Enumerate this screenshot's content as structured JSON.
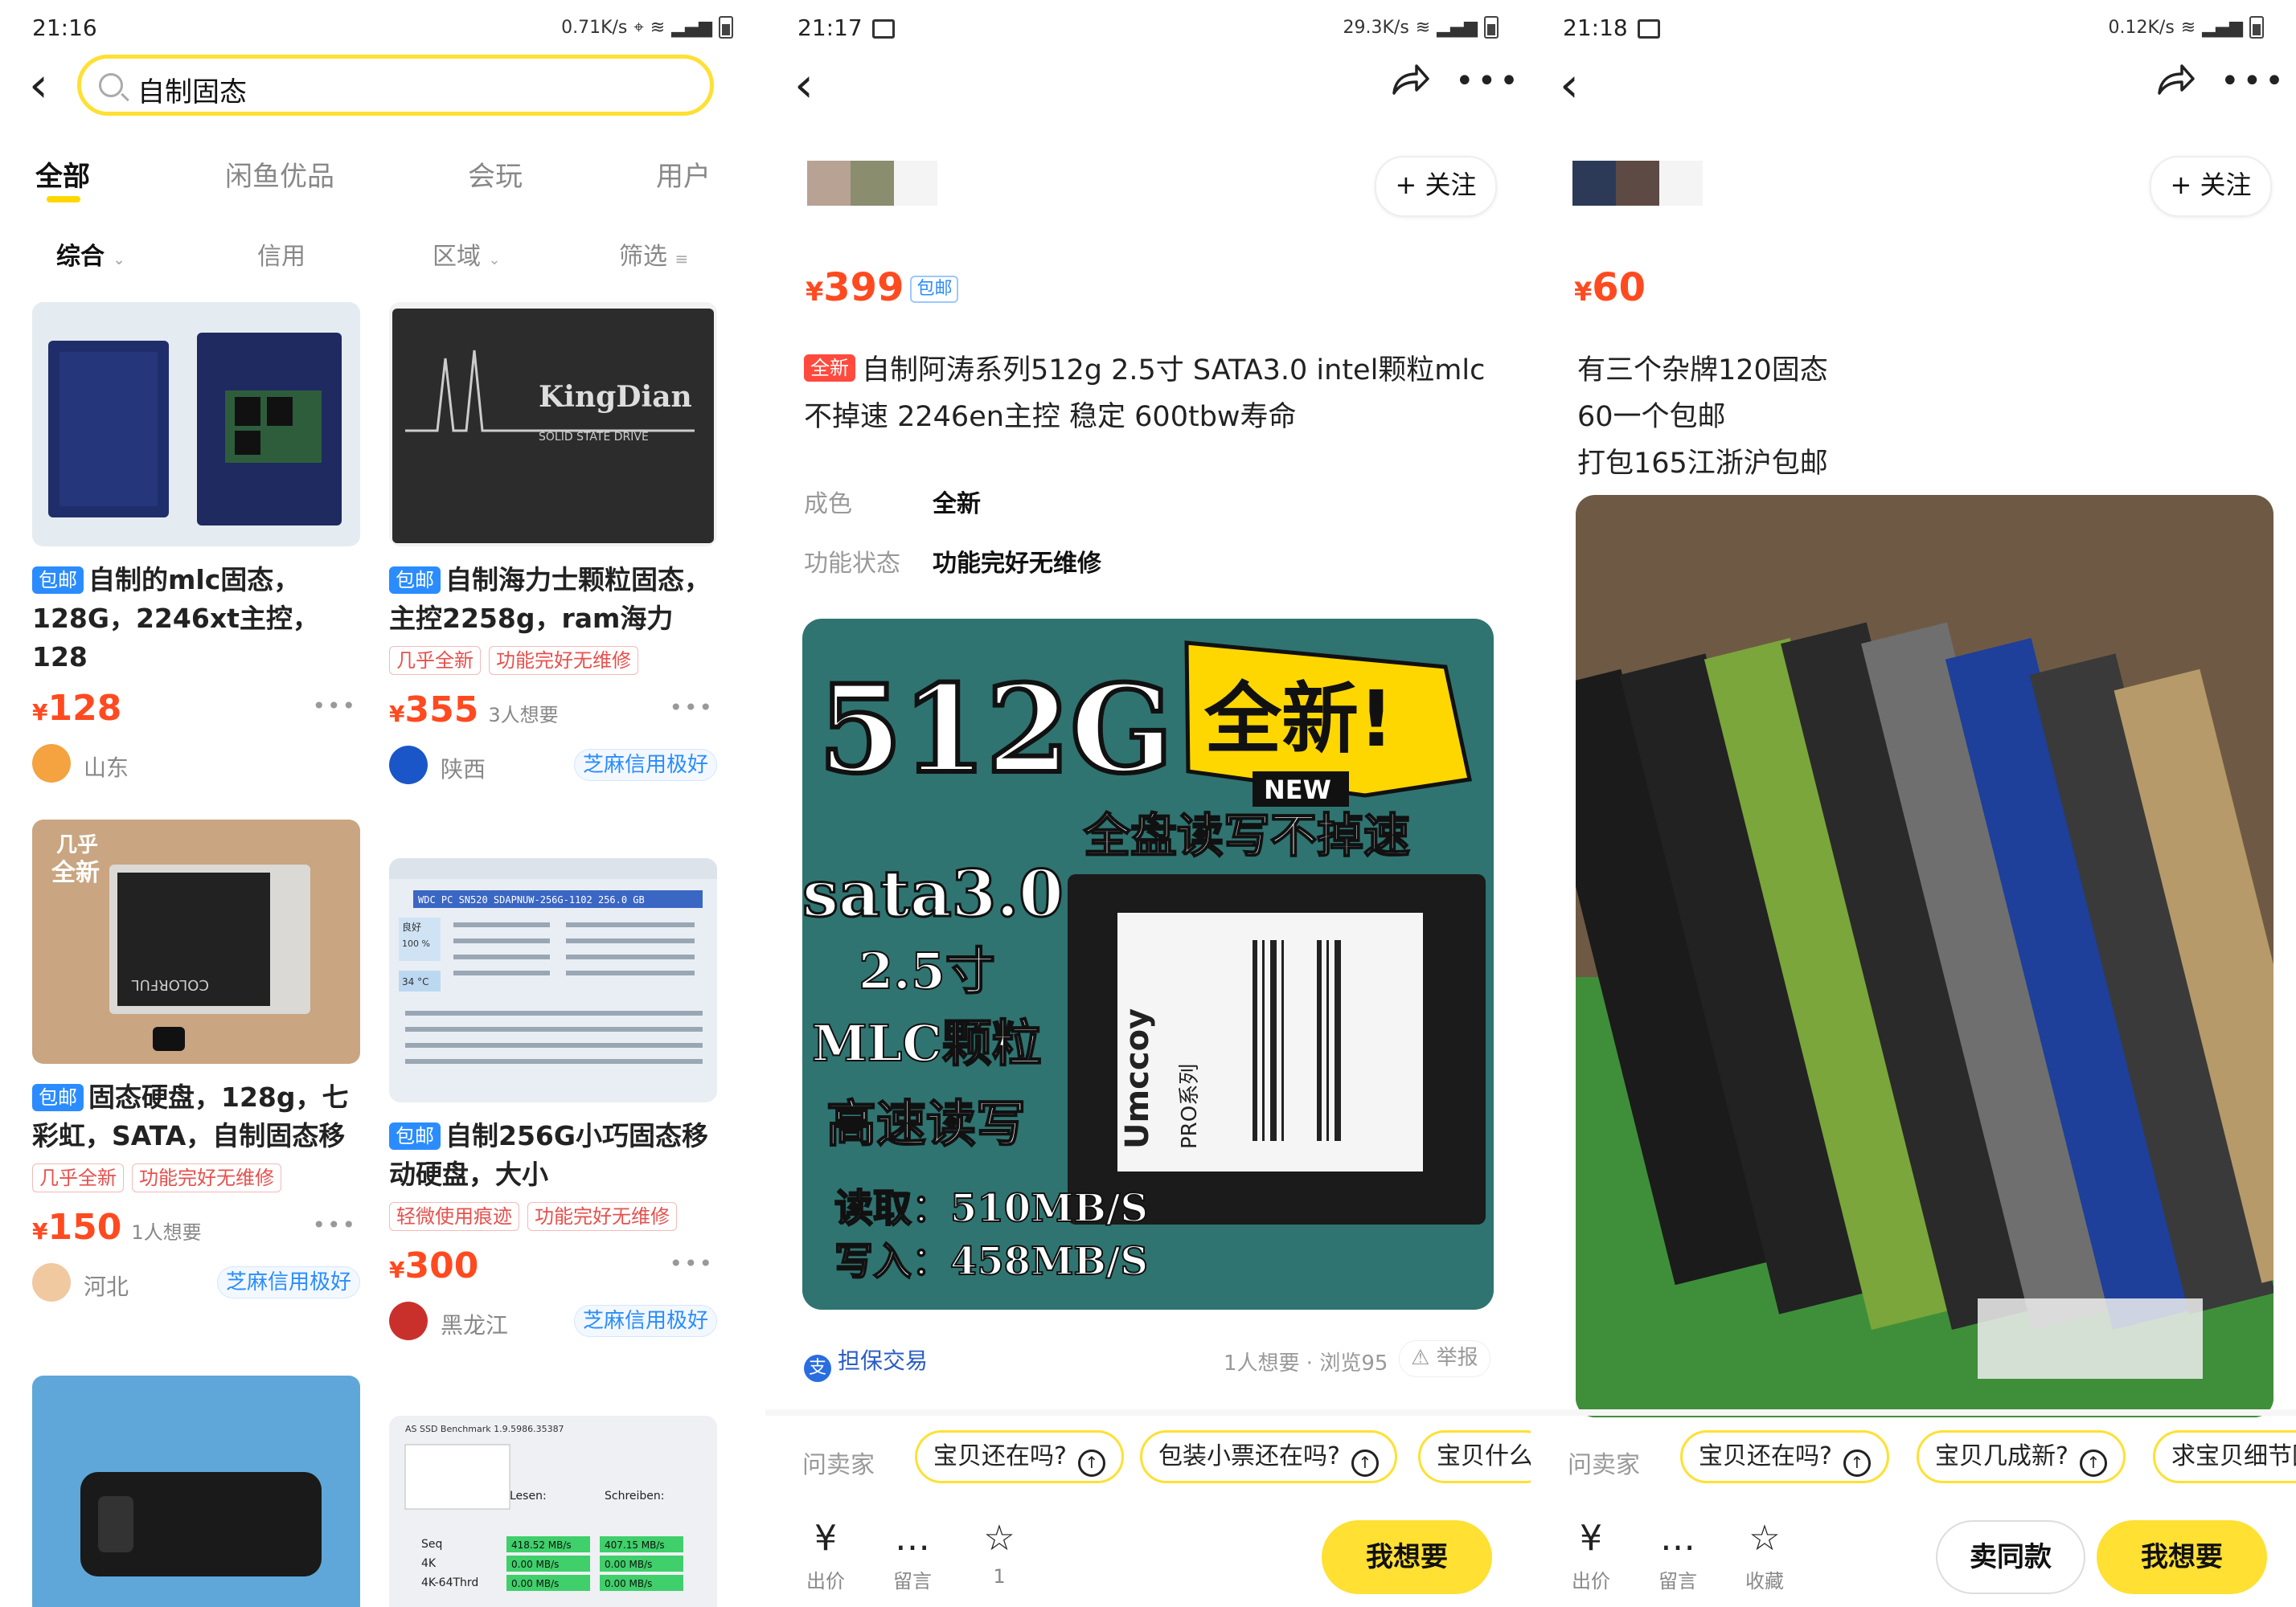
{
  "colors": {
    "accent": "#ffe033",
    "price": "#ff4a20",
    "badge_blue": "#2a8cff",
    "tag_red": "#e8504c"
  },
  "screens": [
    {
      "status": {
        "time": "21:16",
        "speed": "0.71K/s"
      },
      "search": {
        "value": "自制固态"
      },
      "tabs": [
        "全部",
        "闲鱼优品",
        "会玩",
        "用户"
      ],
      "filters": [
        "综合",
        "信用",
        "区域",
        "筛选"
      ],
      "cards": [
        {
          "badge": "包邮",
          "title": "自制的mlc固态，128G，2246xt主控，128",
          "tags": [],
          "price": "128",
          "want": "",
          "location": "山东",
          "credit": ""
        },
        {
          "badge": "包邮",
          "title": "自制海力士颗粒固态，主控2258g，ram海力",
          "tags": [
            "几乎全新",
            "功能完好无维修"
          ],
          "price": "355",
          "want": "3人想要",
          "location": "陕西",
          "credit": "芝麻信用极好",
          "image_text": [
            "KingDian",
            "SOLID STATE DRIVE"
          ]
        },
        {
          "badge": "包邮",
          "title": "固态硬盘，128g，七彩虹，SATA，自制固态移",
          "tags": [
            "几乎全新",
            "功能完好无维修"
          ],
          "price": "150",
          "want": "1人想要",
          "location": "河北",
          "credit": "芝麻信用极好",
          "image_text": [
            "几乎",
            "全新",
            "COLORFUL"
          ]
        },
        {
          "badge": "包邮",
          "title": "自制256G小巧固态移动硬盘，大小",
          "tags": [
            "轻微使用痕迹",
            "功能完好无维修"
          ],
          "price": "300",
          "want": "",
          "location": "黑龙江",
          "credit": "芝麻信用极好",
          "image_text": [
            "WDC PC SN520 SDAPNUW-256G-1102 256.0 GB",
            "良好",
            "100 %",
            "34 °C"
          ]
        },
        {
          "badge": "",
          "title": "",
          "tags": [],
          "price": "",
          "want": "",
          "location": "",
          "credit": ""
        },
        {
          "badge": "",
          "title": "",
          "tags": [],
          "price": "",
          "want": "",
          "location": "",
          "credit": "",
          "image_text": [
            "AS SSD Benchmark 1.9.5986.35387",
            "Lesen:",
            "Schreiben:",
            "Seq",
            "4K",
            "4K-64Thrd",
            "418.52 MB/s",
            "407.15 MB/s",
            "0.00 MB/s",
            "0.00 MB/s",
            "0.00 MB/s",
            "0.00 MB/s"
          ]
        }
      ]
    },
    {
      "status": {
        "time": "21:17",
        "speed": "29.3K/s"
      },
      "follow": "+ 关注",
      "price": "399",
      "price_badge": "包邮",
      "new_tag": "全新",
      "title": "自制阿涛系列512g 2.5寸 SATA3.0  intel颗粒mlc 不掉速 2246en主控 稳定   600tbw寿命",
      "attrs": [
        {
          "k": "成色",
          "v": "全新"
        },
        {
          "k": "功能状态",
          "v": "功能完好无维修"
        }
      ],
      "image_text": {
        "size": "512G",
        "new": "全新!",
        "new_en": "NEW",
        "slogan": "全盘读写不掉速",
        "iface": "sata3.0",
        "form": "2.5寸",
        "chip": "MLC颗粒",
        "speed": "高速读写",
        "read": "读取：510MB/S",
        "write": "写入：458MB/S",
        "brand": "Umccoy",
        "series": "PRO系列"
      },
      "escrow": "担保交易",
      "views": "1人想要 · 浏览95",
      "report": "举报",
      "ask_label": "问卖家",
      "questions": [
        "宝贝还在吗?",
        "包装小票还在吗?",
        "宝贝什么"
      ],
      "actions": [
        {
          "icon": "¥",
          "label": "出价"
        },
        {
          "icon": "…",
          "label": "留言"
        },
        {
          "icon": "☆",
          "label": "1"
        }
      ],
      "want_btn": "我想要"
    },
    {
      "status": {
        "time": "21:18",
        "speed": "0.12K/s"
      },
      "follow": "+ 关注",
      "price": "60",
      "desc_lines": [
        "有三个杂牌120固态",
        "60一个包邮",
        "打包165江浙沪包邮"
      ],
      "ask_label": "问卖家",
      "questions": [
        "宝贝还在吗?",
        "宝贝几成新?",
        "求宝贝细节图"
      ],
      "actions": [
        {
          "icon": "¥",
          "label": "出价"
        },
        {
          "icon": "…",
          "label": "留言"
        },
        {
          "icon": "☆",
          "label": "收藏"
        }
      ],
      "same_btn": "卖同款",
      "want_btn": "我想要"
    }
  ]
}
